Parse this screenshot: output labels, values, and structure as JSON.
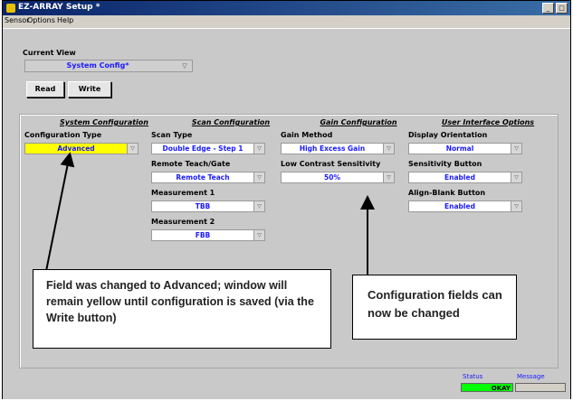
{
  "window": {
    "title": "EZ-ARRAY Setup *"
  },
  "menu": [
    "Sensor",
    "Options",
    "Help"
  ],
  "current_view": {
    "label": "Current View",
    "value": "System Config*"
  },
  "actions": {
    "read": "Read",
    "write": "Write"
  },
  "sections": {
    "system": {
      "heading": "System Configuration",
      "fields": [
        {
          "label": "Configuration Type",
          "value": "Advanced"
        }
      ]
    },
    "scan": {
      "heading": "Scan Configuration",
      "fields": [
        {
          "label": "Scan Type",
          "value": "Double Edge - Step 1"
        },
        {
          "label": "Remote Teach/Gate",
          "value": "Remote Teach"
        },
        {
          "label": "Measurement 1",
          "value": "TBB"
        },
        {
          "label": "Measurement 2",
          "value": "FBB"
        }
      ]
    },
    "gain": {
      "heading": "Gain Configuration",
      "fields": [
        {
          "label": "Gain Method",
          "value": "High Excess Gain"
        },
        {
          "label": "Low Contrast Sensitivity",
          "value": "50%"
        }
      ]
    },
    "ui": {
      "heading": "User Interface Options",
      "fields": [
        {
          "label": "Display Orientation",
          "value": "Normal"
        },
        {
          "label": "Sensitivity Button",
          "value": "Enabled"
        },
        {
          "label": "Align-Blank Button",
          "value": "Enabled"
        }
      ]
    }
  },
  "annotations": {
    "left": "Field was changed to Advanced; window will remain yellow until configuration is saved (via the Write button)",
    "right": "Configuration fields can now be changed"
  },
  "status": {
    "status_label": "Status",
    "message_label": "Message",
    "status_value": "OKAY",
    "message_value": ""
  },
  "colors": {
    "highlight": "#ffff00",
    "status_ok": "#00ff00",
    "value_text": "#1a1aff",
    "titlebar": "#0a246a"
  }
}
